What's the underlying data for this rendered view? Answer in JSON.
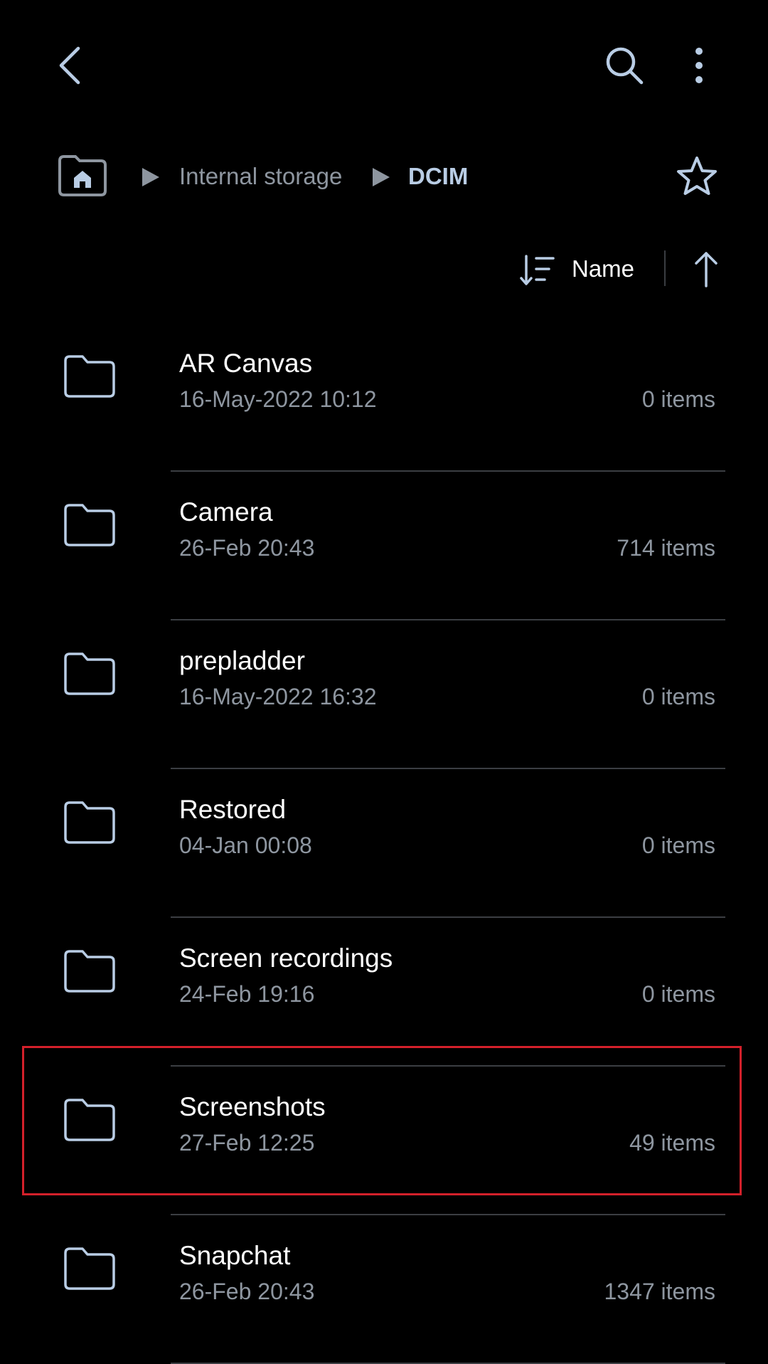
{
  "header": {
    "back_icon": "chevron-left-icon",
    "search_icon": "search-icon",
    "more_icon": "more-vertical-icon"
  },
  "breadcrumb": {
    "home_icon": "home-folder-icon",
    "items": [
      "Internal storage",
      "DCIM"
    ],
    "favorite_icon": "star-icon"
  },
  "sort": {
    "label": "Name",
    "sort_icon": "sort-icon",
    "direction_icon": "arrow-up-icon"
  },
  "folders": [
    {
      "name": "AR Canvas",
      "date": "16-May-2022 10:12",
      "count": "0 items"
    },
    {
      "name": "Camera",
      "date": "26-Feb 20:43",
      "count": "714 items"
    },
    {
      "name": "prepladder",
      "date": "16-May-2022 16:32",
      "count": "0 items"
    },
    {
      "name": "Restored",
      "date": "04-Jan 00:08",
      "count": "0 items"
    },
    {
      "name": "Screen recordings",
      "date": "24-Feb 19:16",
      "count": "0 items"
    },
    {
      "name": "Screenshots",
      "date": "27-Feb 12:25",
      "count": "49 items"
    },
    {
      "name": "Snapchat",
      "date": "26-Feb 20:43",
      "count": "1347 items"
    }
  ],
  "colors": {
    "background": "#000000",
    "icon": "#b9cde5",
    "secondary_text": "#8e96a0",
    "highlight": "#d3202a"
  }
}
